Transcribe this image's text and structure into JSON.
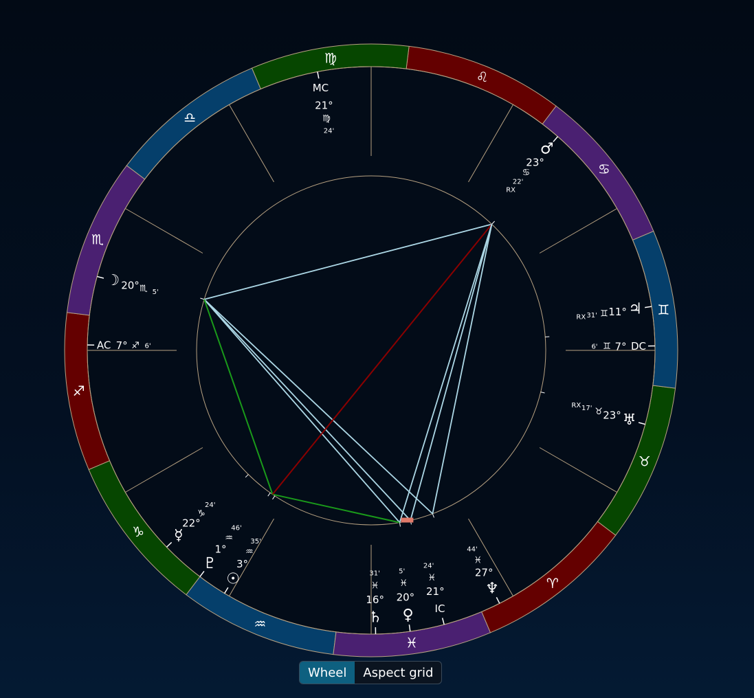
{
  "colors": {
    "fire": "#640000",
    "earth": "#064600",
    "air": "#053f6b",
    "water": "#4a2071",
    "ring_stroke": "#b8a282",
    "aspect_square": "#8b0000",
    "aspect_trine": "#1a9a1a",
    "aspect_conj": "#add8e6"
  },
  "wheel": {
    "zodiac_start_sign": "sagittarius",
    "signs": [
      {
        "name": "sagittarius",
        "glyph": "♐",
        "element": "fire"
      },
      {
        "name": "capricorn",
        "glyph": "♑",
        "element": "earth"
      },
      {
        "name": "aquarius",
        "glyph": "♒",
        "element": "air"
      },
      {
        "name": "pisces",
        "glyph": "♓",
        "element": "water"
      },
      {
        "name": "aries",
        "glyph": "♈",
        "element": "fire"
      },
      {
        "name": "taurus",
        "glyph": "♉",
        "element": "earth"
      },
      {
        "name": "gemini",
        "glyph": "♊",
        "element": "air"
      },
      {
        "name": "cancer",
        "glyph": "♋",
        "element": "water"
      },
      {
        "name": "leo",
        "glyph": "♌",
        "element": "fire"
      },
      {
        "name": "virgo",
        "glyph": "♍",
        "element": "earth"
      },
      {
        "name": "libra",
        "glyph": "♎",
        "element": "air"
      },
      {
        "name": "scorpio",
        "glyph": "♏",
        "element": "water"
      }
    ],
    "ascendant_deg": 247.1,
    "mc_deg": 171.4,
    "house_cusps_deg": [
      247.1,
      277.1,
      307.1,
      337.1,
      7.1,
      37.1,
      67.1,
      97.1,
      127.1,
      157.1,
      187.1,
      217.1
    ],
    "angles": [
      {
        "id": "ac",
        "label": "AC",
        "deg": "7°",
        "sign_glyph": "♐",
        "min": "6'",
        "sign_color": "fire",
        "lon": 247.1
      },
      {
        "id": "mc",
        "label": "MC",
        "deg": "21°",
        "sign_glyph": "♍",
        "min": "24'",
        "sign_color": "earth",
        "lon": 171.4
      },
      {
        "id": "dc",
        "label": "DC",
        "deg": "7°",
        "sign_glyph": "♊",
        "min": "6'",
        "sign_color": "air",
        "lon": 67.1
      },
      {
        "id": "ic",
        "label": "IC",
        "deg": "21°",
        "sign_glyph": "♓",
        "min": "24'",
        "sign_color": "water",
        "lon": 351.4
      }
    ],
    "planets": [
      {
        "id": "moon",
        "glyph": "☽",
        "deg": "20°",
        "sign_glyph": "♏",
        "min": "5'",
        "sign_color": "water",
        "rx": "",
        "lon": 230.1
      },
      {
        "id": "mars",
        "glyph": "♂",
        "deg": "23°",
        "sign_glyph": "♋",
        "min": "22'",
        "sign_color": "water",
        "rx": "RX",
        "lon": 113.4
      },
      {
        "id": "jupiter",
        "glyph": "♃",
        "deg": "11°",
        "sign_glyph": "♊",
        "min": "31'",
        "sign_color": "air",
        "rx": "RX",
        "lon": 71.5
      },
      {
        "id": "uranus",
        "glyph": "♅",
        "deg": "23°",
        "sign_glyph": "♉",
        "min": "17'",
        "sign_color": "earth",
        "rx": "RX",
        "lon": 53.3
      },
      {
        "id": "mercury",
        "glyph": "☿",
        "deg": "22°",
        "sign_glyph": "♑",
        "min": "24'",
        "sign_color": "earth",
        "rx": "",
        "lon": 292.4
      },
      {
        "id": "pluto",
        "glyph": "♇",
        "deg": "1°",
        "sign_glyph": "♒",
        "min": "46'",
        "sign_color": "air",
        "rx": "",
        "lon": 301.8
      },
      {
        "id": "sun",
        "glyph": "☉",
        "deg": "3°",
        "sign_glyph": "♒",
        "min": "35'",
        "sign_color": "air",
        "rx": "",
        "lon": 303.6
      },
      {
        "id": "saturn",
        "glyph": "♄",
        "deg": "16°",
        "sign_glyph": "♓",
        "min": "31'",
        "sign_color": "water",
        "rx": "",
        "lon": 346.5
      },
      {
        "id": "venus",
        "glyph": "♀",
        "deg": "20°",
        "sign_glyph": "♓",
        "min": "5'",
        "sign_color": "water",
        "rx": "",
        "lon": 350.1
      },
      {
        "id": "neptune",
        "glyph": "♆",
        "deg": "27°",
        "sign_glyph": "♓",
        "min": "44'",
        "sign_color": "water",
        "rx": "",
        "lon": 357.7
      }
    ],
    "aspects": [
      {
        "from": "moon",
        "to": "mars",
        "type": "conj"
      },
      {
        "from": "moon",
        "to": "saturn",
        "type": "conj"
      },
      {
        "from": "moon",
        "to": "venus",
        "type": "conj"
      },
      {
        "from": "moon",
        "to": "neptune",
        "type": "conj"
      },
      {
        "from": "moon",
        "to": "pluto_sun",
        "type": "trine"
      },
      {
        "from": "pluto_sun",
        "to": "saturn",
        "type": "trine"
      },
      {
        "from": "pluto_sun",
        "to": "mars",
        "type": "square"
      },
      {
        "from": "mars",
        "to": "saturn",
        "type": "conj"
      },
      {
        "from": "mars",
        "to": "venus",
        "type": "conj"
      },
      {
        "from": "mars",
        "to": "neptune",
        "type": "conj"
      }
    ]
  },
  "view_toggle": {
    "wheel_label": "Wheel",
    "aspect_grid_label": "Aspect grid",
    "active": "wheel"
  }
}
